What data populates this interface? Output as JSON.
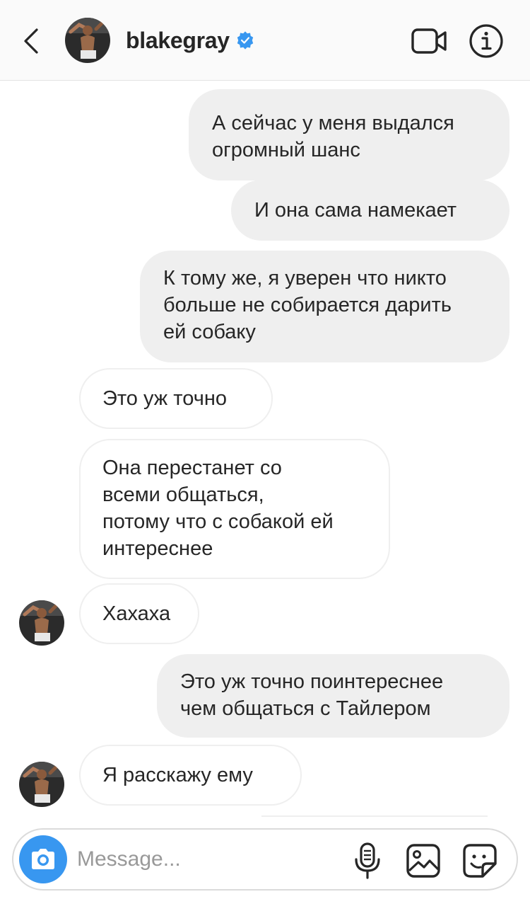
{
  "header": {
    "username": "blakegray",
    "verified": true,
    "accent_color": "#3897f0",
    "icons": [
      "back-chevron-icon",
      "video-call-icon",
      "info-icon",
      "verified-badge-icon"
    ]
  },
  "messages": [
    {
      "direction": "outgoing",
      "text": "А сейчас у меня выдался\nогромный шанс"
    },
    {
      "direction": "outgoing",
      "text": "И она сама намекает"
    },
    {
      "direction": "outgoing",
      "text": "К тому же, я уверен что никто\nбольше не собирается дарить\nей собаку"
    },
    {
      "direction": "incoming",
      "text": "Это уж точно"
    },
    {
      "direction": "incoming",
      "text": "Она перестанет со\nвсеми общаться,\nпотому что с собакой ей\nинтереснее"
    },
    {
      "direction": "incoming",
      "text": "Хахаха"
    },
    {
      "direction": "outgoing",
      "text": "Это уж точно поинтереснее\nчем общаться с Тайлером"
    },
    {
      "direction": "incoming",
      "text": "Я расскажу ему"
    }
  ],
  "composer": {
    "placeholder": "Message...",
    "icons": [
      "camera-icon",
      "microphone-icon",
      "gallery-icon",
      "sticker-icon"
    ]
  }
}
